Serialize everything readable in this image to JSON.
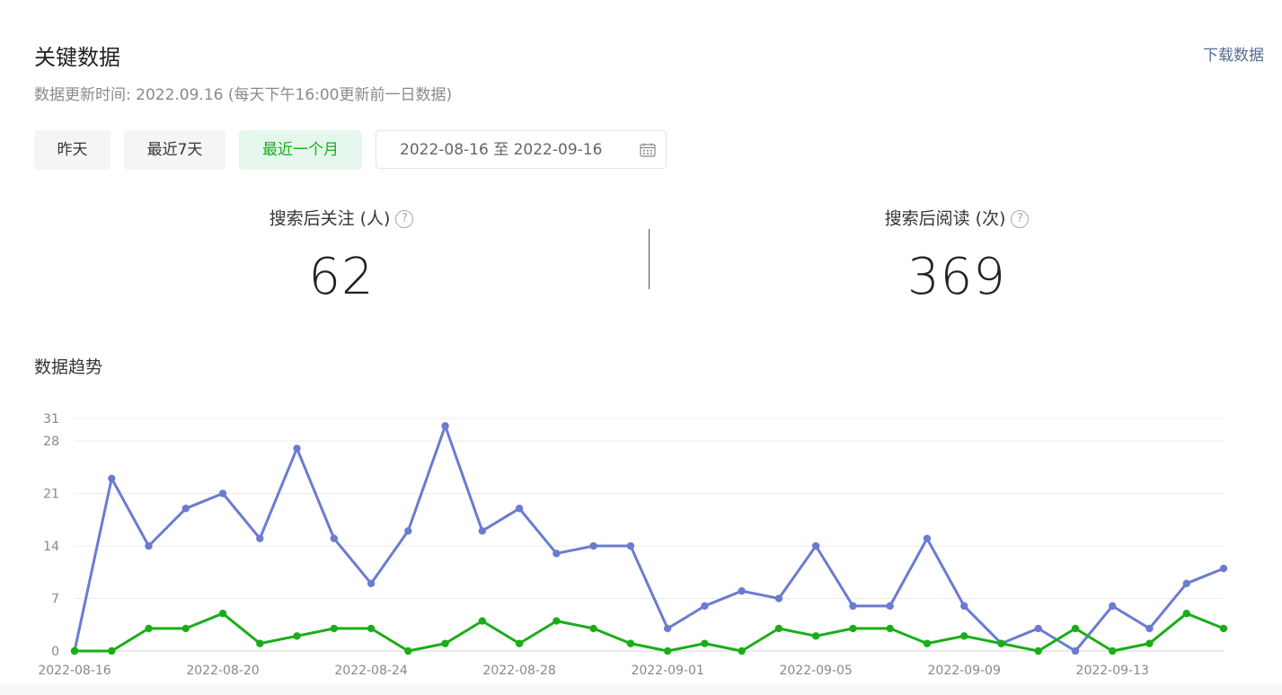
{
  "header": {
    "title": "关键数据",
    "download_label": "下载数据",
    "update_text": "数据更新时间: 2022.09.16 (每天下午16:00更新前一日数据)"
  },
  "range_buttons": [
    {
      "label": "昨天",
      "active": false
    },
    {
      "label": "最近7天",
      "active": false
    },
    {
      "label": "最近一个月",
      "active": true
    }
  ],
  "date_range": {
    "value": "2022-08-16 至 2022-09-16",
    "icon": "calendar-icon"
  },
  "metrics": [
    {
      "label": "搜索后关注 (人)",
      "value": "62",
      "help_icon": "question-icon"
    },
    {
      "label": "搜索后阅读 (次)",
      "value": "369",
      "help_icon": "question-icon"
    }
  ],
  "trend": {
    "title": "数据趋势"
  },
  "colors": {
    "accent_green": "#1aad19",
    "series_reads": "#6b7bd0",
    "series_follows": "#1aad19",
    "link": "#576b95"
  },
  "chart_data": {
    "type": "line",
    "x": [
      "2022-08-16",
      "2022-08-17",
      "2022-08-18",
      "2022-08-19",
      "2022-08-20",
      "2022-08-21",
      "2022-08-22",
      "2022-08-23",
      "2022-08-24",
      "2022-08-25",
      "2022-08-26",
      "2022-08-27",
      "2022-08-28",
      "2022-08-29",
      "2022-08-30",
      "2022-08-31",
      "2022-09-01",
      "2022-09-02",
      "2022-09-03",
      "2022-09-04",
      "2022-09-05",
      "2022-09-06",
      "2022-09-07",
      "2022-09-08",
      "2022-09-09",
      "2022-09-10",
      "2022-09-11",
      "2022-09-12",
      "2022-09-13",
      "2022-09-14",
      "2022-09-15",
      "2022-09-16"
    ],
    "x_tick_labels": [
      "2022-08-16",
      "2022-08-20",
      "2022-08-24",
      "2022-08-28",
      "2022-09-01",
      "2022-09-05",
      "2022-09-09",
      "2022-09-13"
    ],
    "series": [
      {
        "color": "#6b7bd0",
        "values": [
          0,
          23,
          14,
          19,
          21,
          15,
          27,
          15,
          9,
          16,
          30,
          16,
          19,
          13,
          14,
          14,
          3,
          6,
          8,
          7,
          14,
          6,
          6,
          15,
          6,
          1,
          3,
          0,
          6,
          3,
          9,
          11
        ]
      },
      {
        "color": "#1aad19",
        "values": [
          0,
          0,
          3,
          3,
          5,
          1,
          2,
          3,
          3,
          0,
          1,
          4,
          1,
          4,
          3,
          1,
          0,
          1,
          0,
          3,
          2,
          3,
          3,
          1,
          2,
          1,
          0,
          3,
          0,
          1,
          5,
          3
        ]
      }
    ],
    "yticks": [
      0,
      7,
      14,
      21,
      28,
      31
    ],
    "ylim": [
      0,
      31
    ],
    "grid": true,
    "title": "",
    "xlabel": "",
    "ylabel": ""
  }
}
